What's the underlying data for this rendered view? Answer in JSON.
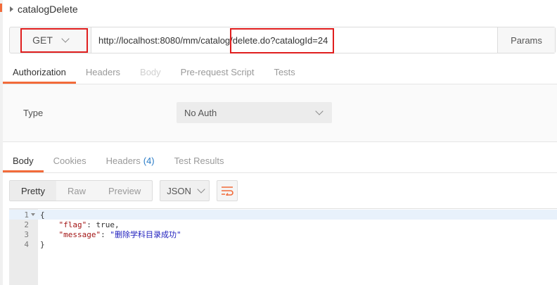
{
  "request": {
    "name": "catalogDelete",
    "method": "GET",
    "url": "http://localhost:8080/mm/catalog/delete.do?catalogId=24",
    "params_label": "Params"
  },
  "request_tabs": [
    {
      "label": "Authorization"
    },
    {
      "label": "Headers"
    },
    {
      "label": "Body"
    },
    {
      "label": "Pre-request Script"
    },
    {
      "label": "Tests"
    }
  ],
  "auth": {
    "type_label": "Type",
    "type_value": "No Auth"
  },
  "response_tabs": [
    {
      "label": "Body"
    },
    {
      "label": "Cookies"
    },
    {
      "label": "Headers",
      "count": "(4)"
    },
    {
      "label": "Test Results"
    }
  ],
  "response_view": {
    "modes": [
      "Pretty",
      "Raw",
      "Preview"
    ],
    "format": "JSON"
  },
  "code_lines": [
    {
      "num": "1",
      "text": "{"
    },
    {
      "num": "2",
      "key": "\"flag\"",
      "sep": ": ",
      "value": "true,"
    },
    {
      "num": "3",
      "key": "\"message\"",
      "sep": ": ",
      "value": "\"删除学科目录成功\""
    },
    {
      "num": "4",
      "text": "}"
    }
  ],
  "colors": {
    "accent": "#f26b3a",
    "highlight_box": "#e01e1e",
    "count_blue": "#2a7cc7"
  }
}
